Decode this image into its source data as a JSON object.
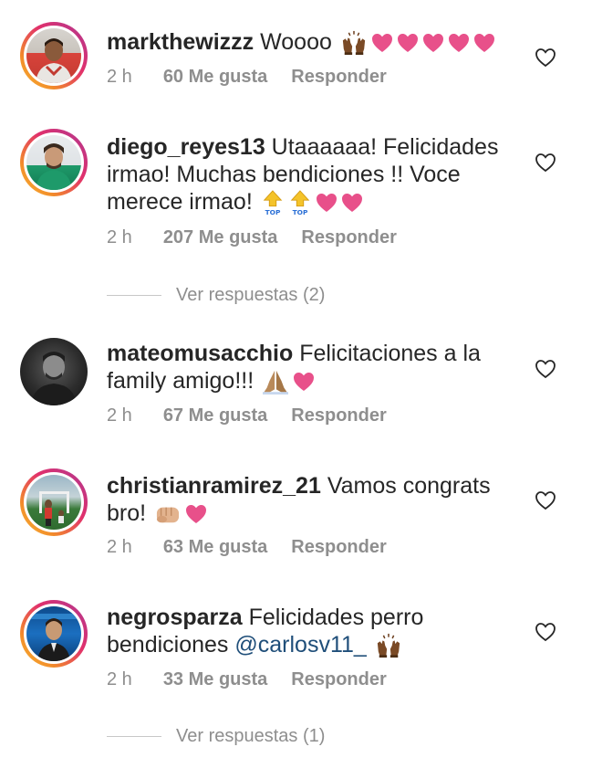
{
  "comments": [
    {
      "username": "markthewizzz",
      "text": "Woooo",
      "time": "2 h",
      "likes": "60 Me gusta",
      "reply": "Responder"
    },
    {
      "username": "diego_reyes13",
      "text": "Utaaaaaa! Felicidades irmao! Muchas bendiciones !! Voce merece irmao!",
      "time": "2 h",
      "likes": "207 Me gusta",
      "reply": "Responder",
      "view_replies": "Ver respuestas (2)"
    },
    {
      "username": "mateomusacchio",
      "text": "Felicitaciones a la family amigo!!!",
      "time": "2 h",
      "likes": "67 Me gusta",
      "reply": "Responder"
    },
    {
      "username": "christianramirez_21",
      "text": "Vamos congrats bro!",
      "time": "2 h",
      "likes": "63 Me gusta",
      "reply": "Responder"
    },
    {
      "username": "negrosparza",
      "text": "Felicidades perro bendiciones",
      "mention": "@carlosv11_",
      "time": "2 h",
      "likes": "33 Me gusta",
      "reply": "Responder",
      "view_replies": "Ver respuestas (1)"
    }
  ],
  "top_badge": "TOP",
  "colors": {
    "text": "#262626",
    "meta": "#8e8e8e",
    "mention": "#1f4e79",
    "heart_emoji": "#e8508a"
  },
  "icons": [
    "like-heart-icon",
    "raising-hands-emoji",
    "pink-heart-emoji",
    "top-arrow-emoji",
    "praying-hands-emoji",
    "fist-emoji"
  ]
}
